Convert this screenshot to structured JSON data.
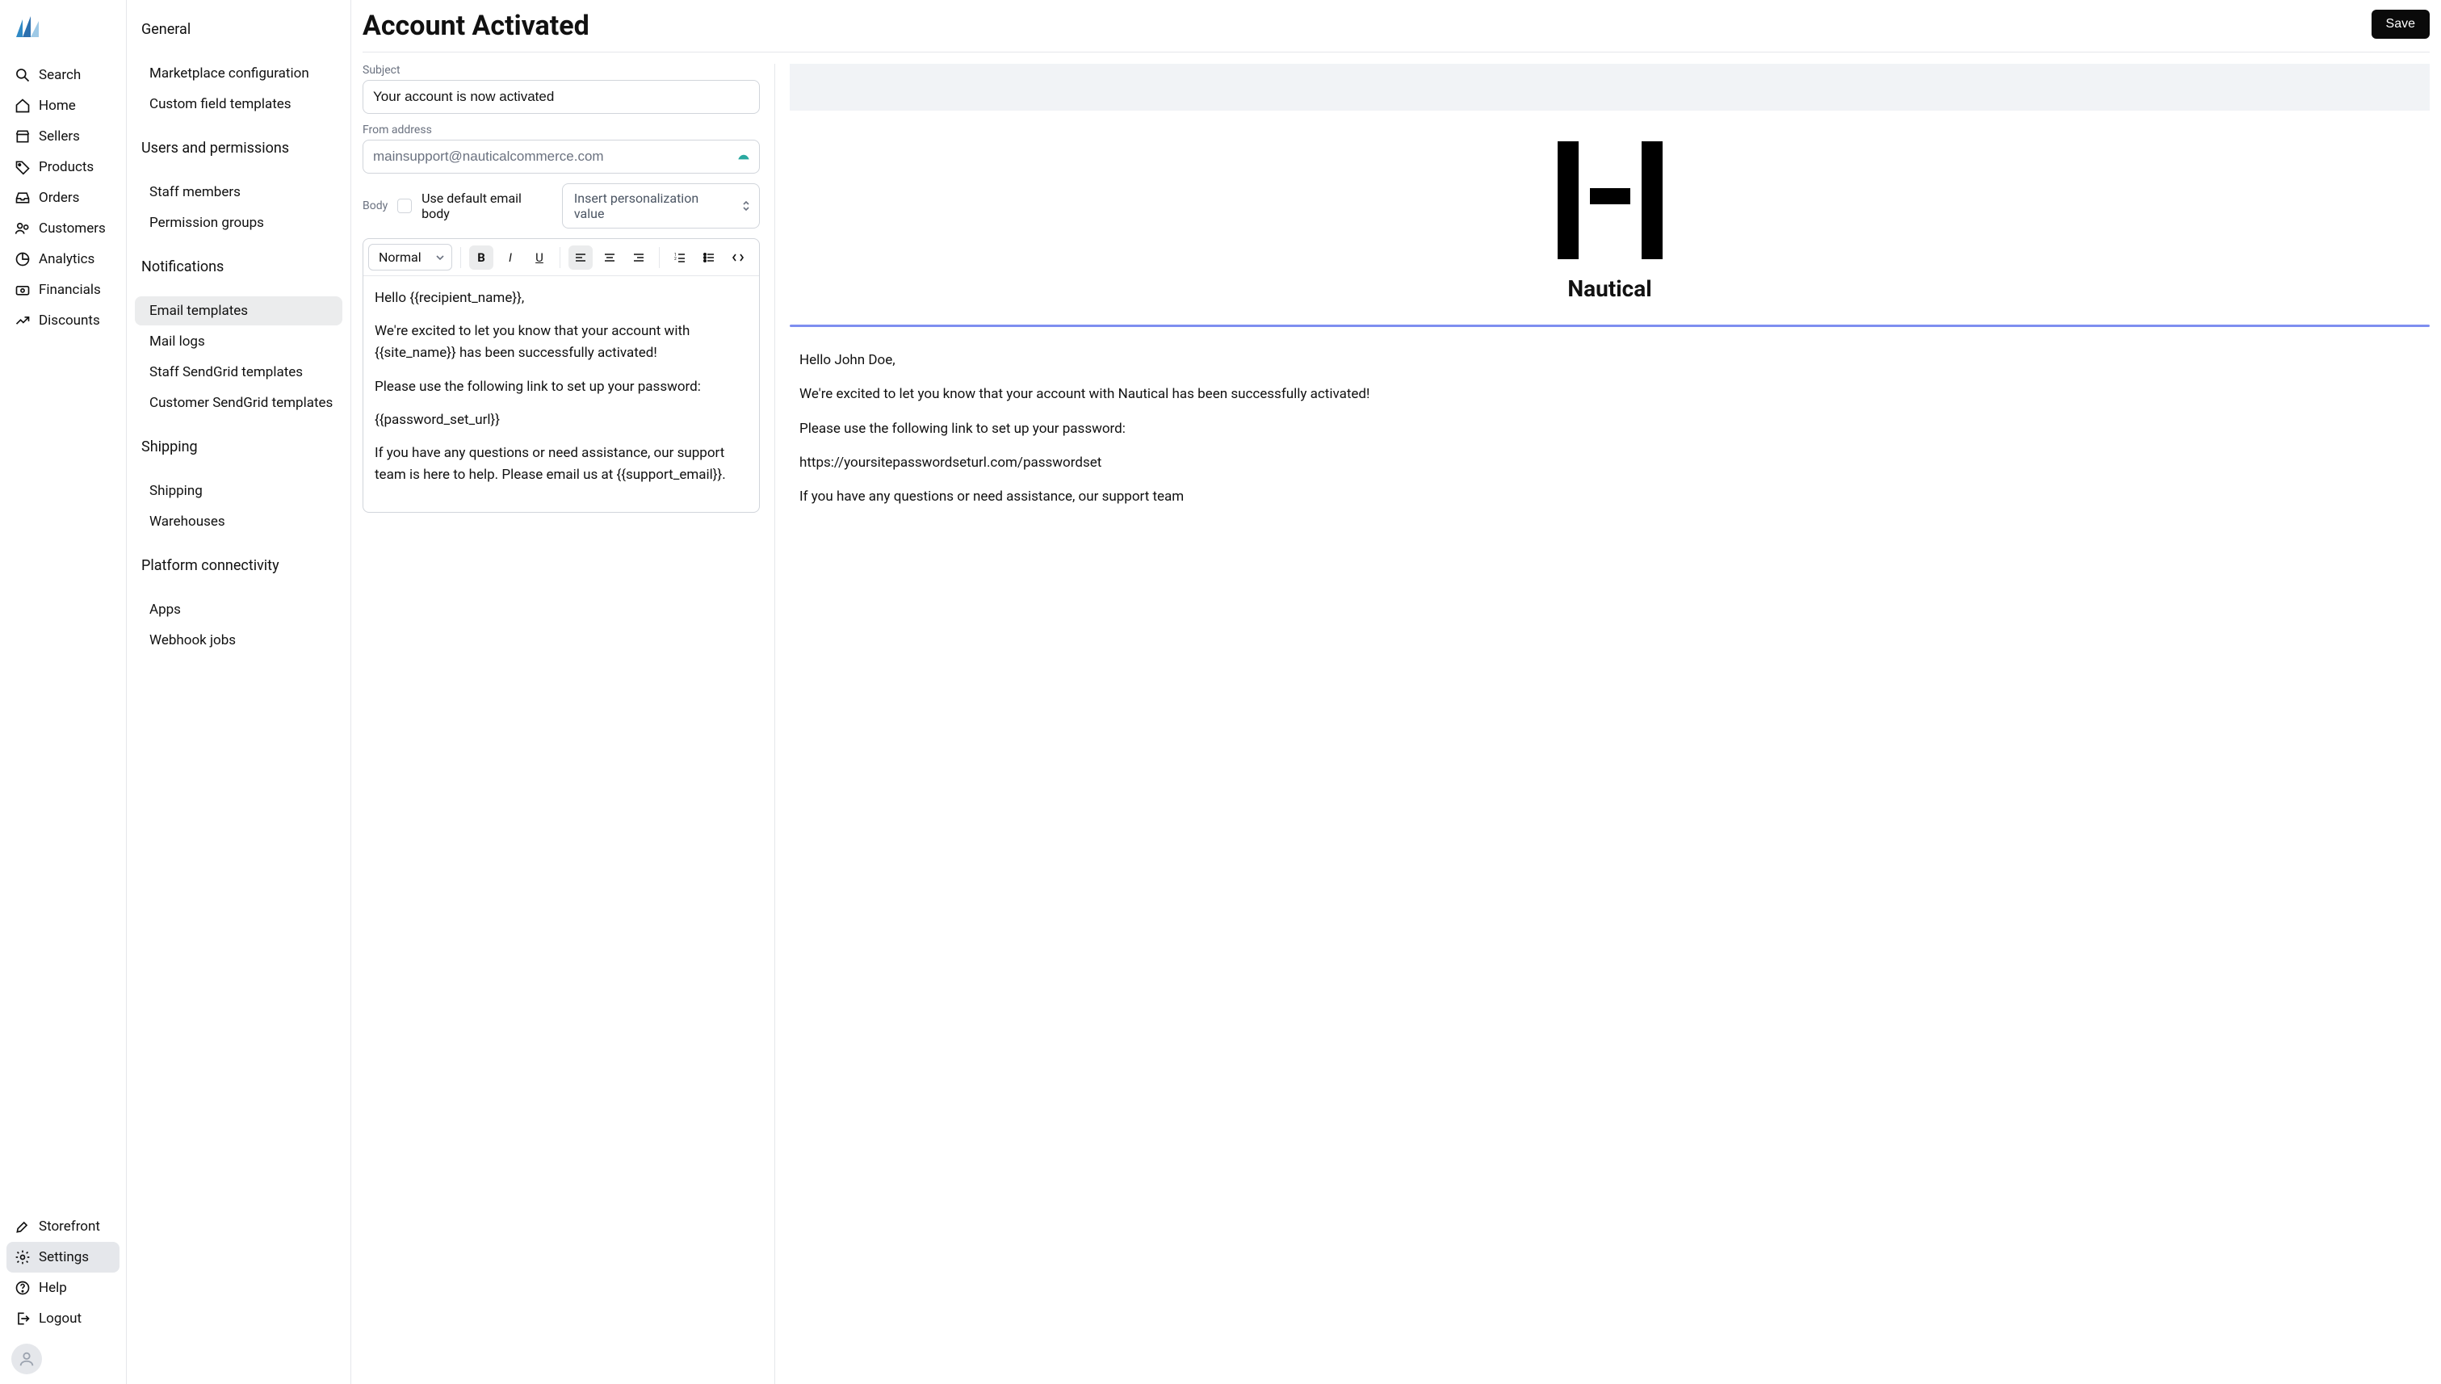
{
  "nav": {
    "items": [
      {
        "key": "search",
        "label": "Search"
      },
      {
        "key": "home",
        "label": "Home"
      },
      {
        "key": "sellers",
        "label": "Sellers"
      },
      {
        "key": "products",
        "label": "Products"
      },
      {
        "key": "orders",
        "label": "Orders"
      },
      {
        "key": "customers",
        "label": "Customers"
      },
      {
        "key": "analytics",
        "label": "Analytics"
      },
      {
        "key": "financials",
        "label": "Financials"
      },
      {
        "key": "discounts",
        "label": "Discounts"
      }
    ],
    "bottom": [
      {
        "key": "storefront",
        "label": "Storefront"
      },
      {
        "key": "settings",
        "label": "Settings"
      },
      {
        "key": "help",
        "label": "Help"
      },
      {
        "key": "logout",
        "label": "Logout"
      }
    ]
  },
  "settings_nav": {
    "groups": [
      {
        "label": "General",
        "items": [
          "Marketplace configuration",
          "Custom field templates"
        ]
      },
      {
        "label": "Users and permissions",
        "items": [
          "Staff members",
          "Permission groups"
        ]
      },
      {
        "label": "Notifications",
        "items": [
          "Email templates",
          "Mail logs",
          "Staff SendGrid templates",
          "Customer SendGrid templates"
        ]
      },
      {
        "label": "Shipping",
        "items": [
          "Shipping",
          "Warehouses"
        ]
      },
      {
        "label": "Platform connectivity",
        "items": [
          "Apps",
          "Webhook jobs"
        ]
      }
    ],
    "active": "Email templates"
  },
  "page": {
    "title": "Account Activated",
    "save_label": "Save"
  },
  "form": {
    "subject_label": "Subject",
    "subject_value": "Your account is now activated",
    "from_label": "From address",
    "from_value": "mainsupport@nauticalcommerce.com",
    "body_label": "Body",
    "use_default_label": "Use default email body",
    "personalization_label": "Insert personalization value",
    "format_select": "Normal",
    "body_paragraphs": [
      "Hello {{recipient_name}},",
      "We're excited to let you know that your account with {{site_name}} has been successfully activated!",
      "Please use the following link to set up your password:",
      "{{password_set_url}}",
      "If you have any questions or need assistance, our support team is here to help. Please email us at {{support_email}}."
    ]
  },
  "preview": {
    "brand": "Nautical",
    "paragraphs": [
      "Hello John Doe,",
      "We're excited to let you know that your account with Nautical has been successfully activated!",
      "Please use the following link to set up your password:",
      "https://yoursitepasswordseturl.com/passwordset",
      "If you have any questions or need assistance, our support team"
    ]
  }
}
